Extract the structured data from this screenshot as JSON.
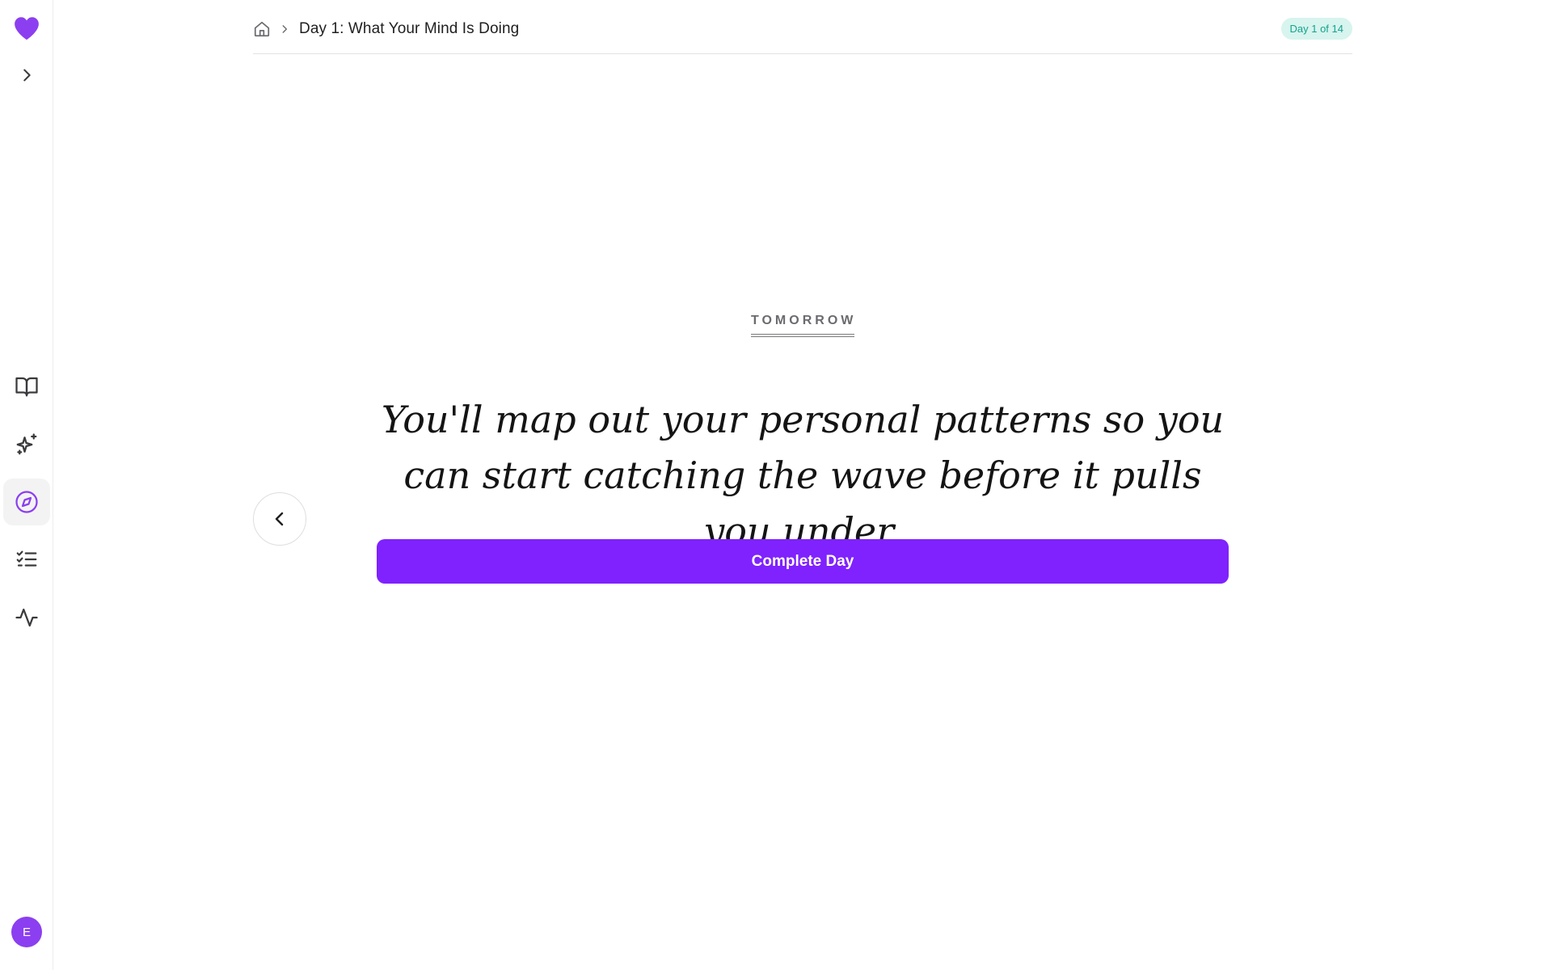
{
  "sidebar": {
    "avatar_initial": "E",
    "brand_color": "#8b3ff0",
    "icons": [
      "heart-icon",
      "chevron-right-icon",
      "book-open-icon",
      "sparkles-icon",
      "compass-icon",
      "list-checks-icon",
      "activity-icon"
    ],
    "active_item": "compass"
  },
  "header": {
    "breadcrumb_title": "Day 1: What Your Mind Is Doing",
    "badge": "Day 1 of 14"
  },
  "content": {
    "kicker": "TOMORROW",
    "quote": "You'll map out your personal patterns so you can start catching the wave before it pulls you under.",
    "complete_button": "Complete Day"
  },
  "colors": {
    "accent": "#7f22fe",
    "badge_bg": "#d7f4ef",
    "badge_text": "#14a38b"
  }
}
